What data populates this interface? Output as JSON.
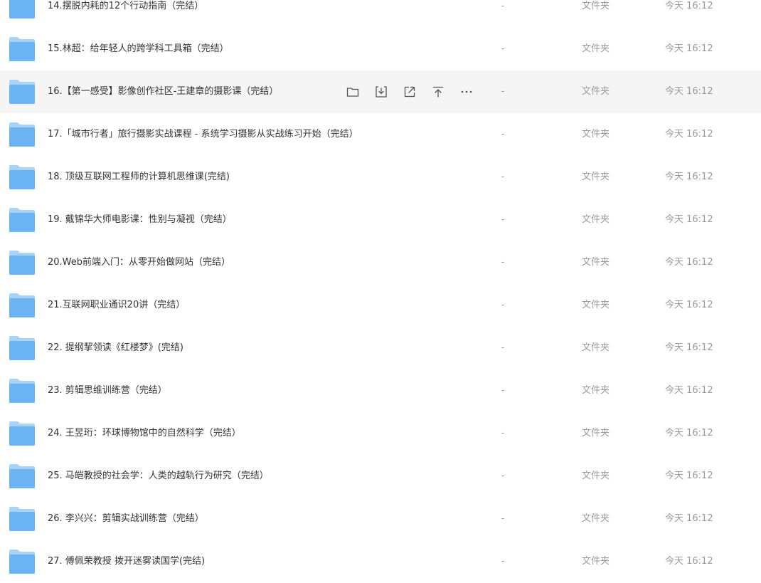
{
  "colors": {
    "folder_main": "#6cb5f5",
    "folder_back": "#a9d4fa",
    "hover_background": "#f5f5f6",
    "meta_text": "#9a9a9a"
  },
  "hover_actions": [
    {
      "name": "move-to-folder-icon",
      "icon": "folder-icon"
    },
    {
      "name": "download-icon",
      "icon": "download-icon"
    },
    {
      "name": "share-icon",
      "icon": "external-link-icon"
    },
    {
      "name": "pin-to-top-icon",
      "icon": "arrow-up-to-line-icon"
    },
    {
      "name": "more-options-icon",
      "icon": "ellipsis-icon"
    }
  ],
  "files": [
    {
      "name": "14.摆脱内耗的12个行动指南（完结）",
      "size": "-",
      "type": "文件夹",
      "modified": "今天 16:12"
    },
    {
      "name": "15.林超：给年轻人的跨学科工具箱（完结）",
      "size": "-",
      "type": "文件夹",
      "modified": "今天 16:12"
    },
    {
      "name": "16.【第一感受】影像创作社区-王建章的摄影课（完结）",
      "size": "-",
      "type": "文件夹",
      "modified": "今天 16:12",
      "hovered": true
    },
    {
      "name": "17.「城市行者」旅行摄影实战课程 - 系统学习摄影从实战练习开始（完结）",
      "size": "-",
      "type": "文件夹",
      "modified": "今天 16:12"
    },
    {
      "name": "18. 顶级互联网工程师的计算机思维课(完结)",
      "size": "-",
      "type": "文件夹",
      "modified": "今天 16:12"
    },
    {
      "name": "19. 戴锦华大师电影课：性别与凝视（完结）",
      "size": "-",
      "type": "文件夹",
      "modified": "今天 16:12"
    },
    {
      "name": "20.Web前端入门：从零开始做网站（完结）",
      "size": "-",
      "type": "文件夹",
      "modified": "今天 16:12"
    },
    {
      "name": "21.互联网职业通识20讲（完结）",
      "size": "-",
      "type": "文件夹",
      "modified": "今天 16:12"
    },
    {
      "name": "22. 提纲挈领读《红楼梦》(完结)",
      "size": "-",
      "type": "文件夹",
      "modified": "今天 16:12"
    },
    {
      "name": "23. 剪辑思维训练营（完结）",
      "size": "-",
      "type": "文件夹",
      "modified": "今天 16:12"
    },
    {
      "name": "24. 王昱珩：环球博物馆中的自然科学（完结）",
      "size": "-",
      "type": "文件夹",
      "modified": "今天 16:12"
    },
    {
      "name": "25. 马皑教授的社会学：人类的越轨行为研究（完结）",
      "size": "-",
      "type": "文件夹",
      "modified": "今天 16:12"
    },
    {
      "name": "26. 李兴兴：剪辑实战训练营（完结）",
      "size": "-",
      "type": "文件夹",
      "modified": "今天 16:12"
    },
    {
      "name": "27. 傅佩荣教授 拨开迷雾读国学(完结)",
      "size": "-",
      "type": "文件夹",
      "modified": "今天 16:12"
    }
  ]
}
